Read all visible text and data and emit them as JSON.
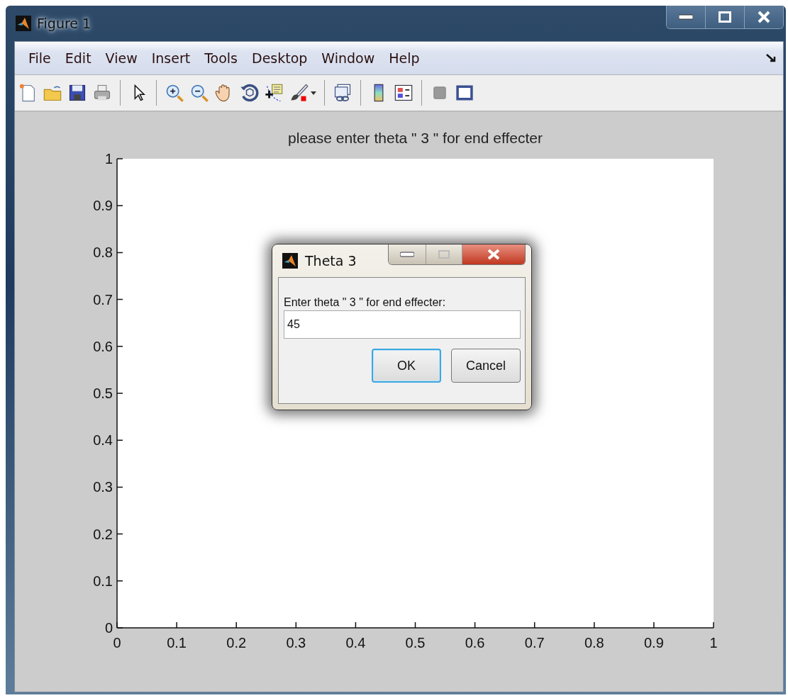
{
  "window": {
    "title": "Figure 1"
  },
  "menu": [
    "File",
    "Edit",
    "View",
    "Insert",
    "Tools",
    "Desktop",
    "Window",
    "Help"
  ],
  "figure": {
    "chart_data": {
      "type": "line",
      "title": "please enter theta \" 3 \" for end effecter",
      "xlim": [
        0,
        1
      ],
      "ylim": [
        0,
        1
      ],
      "xticks": [
        {
          "value": 0,
          "label": "0"
        },
        {
          "value": 0.1,
          "label": "0.1"
        },
        {
          "value": 0.2,
          "label": "0.2"
        },
        {
          "value": 0.3,
          "label": "0.3"
        },
        {
          "value": 0.4,
          "label": "0.4"
        },
        {
          "value": 0.5,
          "label": "0.5"
        },
        {
          "value": 0.6,
          "label": "0.6"
        },
        {
          "value": 0.7,
          "label": "0.7"
        },
        {
          "value": 0.8,
          "label": "0.8"
        },
        {
          "value": 0.9,
          "label": "0.9"
        },
        {
          "value": 1,
          "label": "1"
        }
      ],
      "yticks": [
        {
          "value": 0,
          "label": "0"
        },
        {
          "value": 0.1,
          "label": "0.1"
        },
        {
          "value": 0.2,
          "label": "0.2"
        },
        {
          "value": 0.3,
          "label": "0.3"
        },
        {
          "value": 0.4,
          "label": "0.4"
        },
        {
          "value": 0.5,
          "label": "0.5"
        },
        {
          "value": 0.6,
          "label": "0.6"
        },
        {
          "value": 0.7,
          "label": "0.7"
        },
        {
          "value": 0.8,
          "label": "0.8"
        },
        {
          "value": 0.9,
          "label": "0.9"
        },
        {
          "value": 1,
          "label": "1"
        }
      ]
    }
  },
  "dialog": {
    "title": "Theta 3",
    "prompt": "Enter theta \" 3 \" for end effecter:",
    "value": "45",
    "buttons": [
      {
        "label": "OK",
        "focused": true
      },
      {
        "label": "Cancel",
        "focused": false
      }
    ]
  }
}
